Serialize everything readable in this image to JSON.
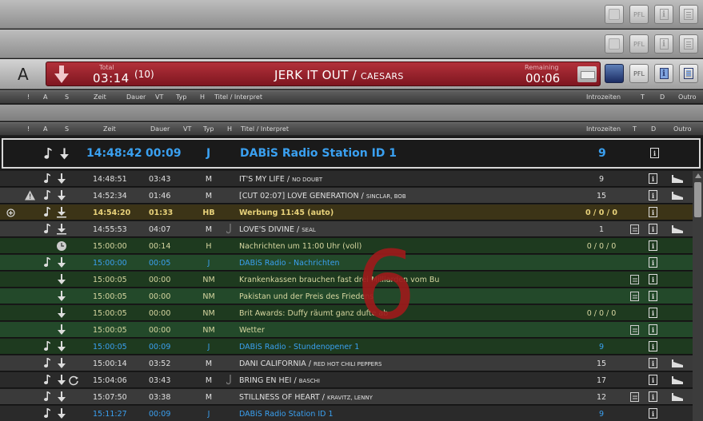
{
  "decks": {
    "deck_a_letter": "A",
    "pfl_label": "PFL",
    "player": {
      "total_label": "Total",
      "total_value": "03:14",
      "count": "(10)",
      "title": "JERK IT OUT",
      "title_sep": " / ",
      "artist": "CAESARS",
      "remaining_label": "Remaining",
      "remaining_value": "00:06"
    }
  },
  "headers": {
    "excl": "!",
    "a": "A",
    "s": "S",
    "zeit": "Zeit",
    "dauer": "Dauer",
    "vt": "VT",
    "typ": "Typ",
    "h": "H",
    "titel": "Titel / Interpret",
    "intro": "Introzeiten",
    "t": "T",
    "d": "D",
    "outro": "Outro"
  },
  "featured": {
    "time": "14:48:42",
    "duration": "00:09",
    "type": "J",
    "title": "DABiS Radio Station ID 1",
    "intro": "9"
  },
  "rows": [
    {
      "time": "14:48:51",
      "dur": "03:43",
      "typ": "M",
      "title": "IT'S MY LIFE",
      "artist": "NO DOUBT",
      "intro": "9"
    },
    {
      "time": "14:52:34",
      "dur": "01:46",
      "typ": "M",
      "title": "[CUT 02:07] LOVE GENERATION",
      "artist": "SINCLAR, BOB",
      "intro": "15"
    },
    {
      "time": "14:54:20",
      "dur": "01:33",
      "typ": "HB",
      "title": "Werbung 11:45 (auto)",
      "artist": "",
      "intro": "0 / 0 / 0"
    },
    {
      "time": "14:55:53",
      "dur": "04:07",
      "typ": "M",
      "title": "LOVE'S DIVINE",
      "artist": "SEAL",
      "intro": "1"
    },
    {
      "time": "15:00:00",
      "dur": "00:14",
      "typ": "H",
      "title": "Nachrichten um 11:00 Uhr  (voll)",
      "artist": "",
      "intro": "0 / 0 / 0"
    },
    {
      "time": "15:00:00",
      "dur": "00:05",
      "typ": "J",
      "title": "DABiS Radio - Nachrichten",
      "artist": "",
      "intro": ""
    },
    {
      "time": "15:00:05",
      "dur": "00:00",
      "typ": "NM",
      "title": "Krankenkassen brauchen fast drei Milliarden vom Bu",
      "artist": "",
      "intro": ""
    },
    {
      "time": "15:00:05",
      "dur": "00:00",
      "typ": "NM",
      "title": "Pakistan und der Preis des Friedens",
      "artist": "",
      "intro": ""
    },
    {
      "time": "15:00:05",
      "dur": "00:00",
      "typ": "NM",
      "title": "Brit Awards: Duffy räumt ganz dufte ab",
      "artist": "",
      "intro": "0 / 0 / 0"
    },
    {
      "time": "15:00:05",
      "dur": "00:00",
      "typ": "NM",
      "title": "Wetter",
      "artist": "",
      "intro": ""
    },
    {
      "time": "15:00:05",
      "dur": "00:09",
      "typ": "J",
      "title": "DABiS Radio - Stundenopener 1",
      "artist": "",
      "intro": "9"
    },
    {
      "time": "15:00:14",
      "dur": "03:52",
      "typ": "M",
      "title": "DANI CALIFORNIA",
      "artist": "RED HOT CHILI PEPPERS",
      "intro": "15"
    },
    {
      "time": "15:04:06",
      "dur": "03:43",
      "typ": "M",
      "title": "BRING EN HEI",
      "artist": "BASCHI",
      "intro": "17"
    },
    {
      "time": "15:07:50",
      "dur": "03:38",
      "typ": "M",
      "title": "STILLNESS OF HEART",
      "artist": "KRAVITZ, LENNY",
      "intro": "12"
    },
    {
      "time": "15:11:27",
      "dur": "00:09",
      "typ": "J",
      "title": "DABiS Radio Station ID 1",
      "artist": "",
      "intro": "9"
    }
  ],
  "overlay_number": "6",
  "colors": {
    "player_red": "#9a2530",
    "jingle_blue": "#3aa0f0",
    "ad_yellow": "#e8d27a",
    "news_green": "#1e3a1f",
    "overlay_red": "#9c1b1b"
  }
}
